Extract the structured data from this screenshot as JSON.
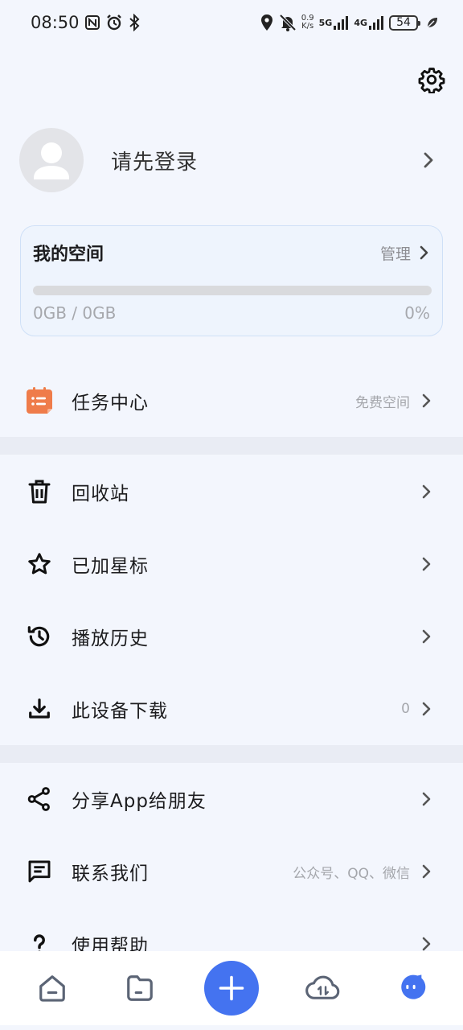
{
  "status_bar": {
    "time": "08:50",
    "speed_top": "0.9",
    "speed_bottom": "K/s",
    "net1": "5G",
    "net2": "4G",
    "battery": "54"
  },
  "profile": {
    "login_prompt": "请先登录"
  },
  "space": {
    "title": "我的空间",
    "manage_label": "管理",
    "usage": "0GB / 0GB",
    "percent": "0%",
    "fill_fraction": 0
  },
  "menu_group1": [
    {
      "label": "任务中心",
      "extra": "免费空间"
    }
  ],
  "menu_group2": [
    {
      "label": "回收站",
      "extra": ""
    },
    {
      "label": "已加星标",
      "extra": ""
    },
    {
      "label": "播放历史",
      "extra": ""
    },
    {
      "label": "此设备下载",
      "extra": "0"
    }
  ],
  "menu_group3": [
    {
      "label": "分享App给朋友",
      "extra": ""
    },
    {
      "label": "联系我们",
      "extra": "公众号、QQ、微信"
    },
    {
      "label": "使用帮助",
      "extra": ""
    }
  ],
  "icons": {
    "settings": "gear-icon",
    "task": "task-calendar-icon",
    "trash": "trash-icon",
    "star": "star-icon",
    "history": "history-icon",
    "download": "download-icon",
    "share": "share-icon",
    "contact": "message-icon",
    "help": "question-icon"
  },
  "colors": {
    "accent": "#4473f0",
    "task_icon": "#ef7c4a",
    "background": "#f3f6fd"
  }
}
